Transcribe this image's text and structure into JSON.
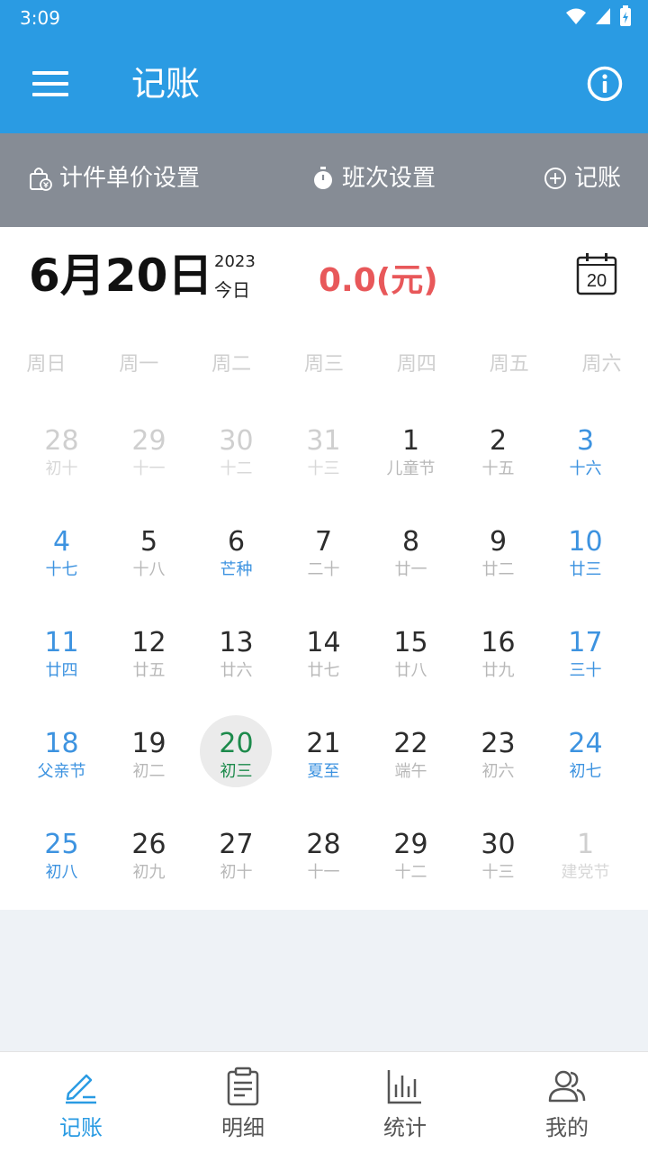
{
  "status": {
    "time": "3:09"
  },
  "appbar": {
    "title": "记账"
  },
  "toolbar": {
    "piece_price": "计件单价设置",
    "shift": "班次设置",
    "add": "记账"
  },
  "summary": {
    "date": "6月20日",
    "year": "2023",
    "today": "今日",
    "amount": "0.0(元)",
    "calendar_icon_day": "20"
  },
  "weekdays": [
    "周日",
    "周一",
    "周二",
    "周三",
    "周四",
    "周五",
    "周六"
  ],
  "calendar": {
    "days": [
      {
        "d": "28",
        "l": "初十",
        "t": "other"
      },
      {
        "d": "29",
        "l": "十一",
        "t": "other"
      },
      {
        "d": "30",
        "l": "十二",
        "t": "other"
      },
      {
        "d": "31",
        "l": "十三",
        "t": "other"
      },
      {
        "d": "1",
        "l": "儿童节",
        "t": ""
      },
      {
        "d": "2",
        "l": "十五",
        "t": ""
      },
      {
        "d": "3",
        "l": "十六",
        "t": "weekend"
      },
      {
        "d": "4",
        "l": "十七",
        "t": "weekend"
      },
      {
        "d": "5",
        "l": "十八",
        "t": ""
      },
      {
        "d": "6",
        "l": "芒种",
        "t": "festival"
      },
      {
        "d": "7",
        "l": "二十",
        "t": ""
      },
      {
        "d": "8",
        "l": "廿一",
        "t": ""
      },
      {
        "d": "9",
        "l": "廿二",
        "t": ""
      },
      {
        "d": "10",
        "l": "廿三",
        "t": "weekend"
      },
      {
        "d": "11",
        "l": "廿四",
        "t": "weekend"
      },
      {
        "d": "12",
        "l": "廿五",
        "t": ""
      },
      {
        "d": "13",
        "l": "廿六",
        "t": ""
      },
      {
        "d": "14",
        "l": "廿七",
        "t": ""
      },
      {
        "d": "15",
        "l": "廿八",
        "t": ""
      },
      {
        "d": "16",
        "l": "廿九",
        "t": ""
      },
      {
        "d": "17",
        "l": "三十",
        "t": "weekend"
      },
      {
        "d": "18",
        "l": "父亲节",
        "t": "weekend"
      },
      {
        "d": "19",
        "l": "初二",
        "t": ""
      },
      {
        "d": "20",
        "l": "初三",
        "t": "selected"
      },
      {
        "d": "21",
        "l": "夏至",
        "t": "festival"
      },
      {
        "d": "22",
        "l": "端午",
        "t": ""
      },
      {
        "d": "23",
        "l": "初六",
        "t": ""
      },
      {
        "d": "24",
        "l": "初七",
        "t": "weekend"
      },
      {
        "d": "25",
        "l": "初八",
        "t": "weekend"
      },
      {
        "d": "26",
        "l": "初九",
        "t": ""
      },
      {
        "d": "27",
        "l": "初十",
        "t": ""
      },
      {
        "d": "28",
        "l": "十一",
        "t": ""
      },
      {
        "d": "29",
        "l": "十二",
        "t": ""
      },
      {
        "d": "30",
        "l": "十三",
        "t": ""
      },
      {
        "d": "1",
        "l": "建党节",
        "t": "other"
      }
    ]
  },
  "nav": [
    {
      "label": "记账",
      "icon": "pen-icon",
      "active": true
    },
    {
      "label": "明细",
      "icon": "clipboard-icon",
      "active": false
    },
    {
      "label": "统计",
      "icon": "bar-chart-icon",
      "active": false
    },
    {
      "label": "我的",
      "icon": "users-icon",
      "active": false
    }
  ],
  "colors": {
    "primary": "#2a9be3",
    "toolbar": "#868c95",
    "amount": "#e8585a",
    "selected": "#1c8a4b",
    "weekend": "#3d93e0"
  }
}
